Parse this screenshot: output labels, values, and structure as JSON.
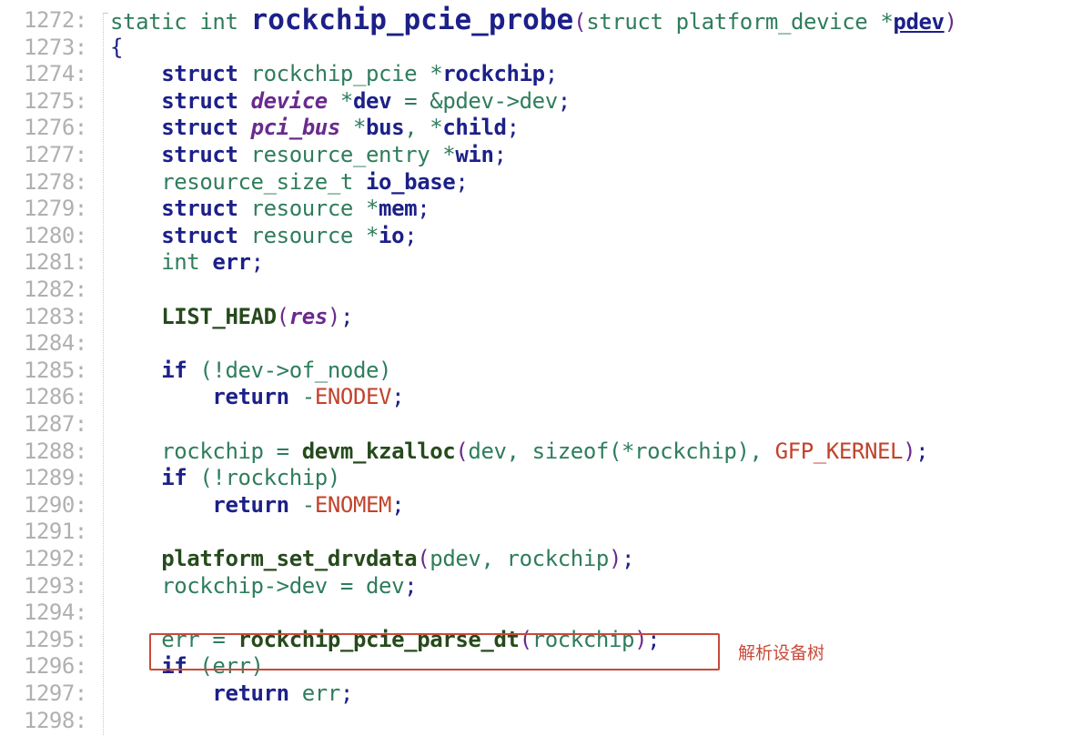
{
  "lines": [
    {
      "num": "1272:",
      "code": [
        [
          "kw-plain",
          "static int "
        ],
        [
          "fn",
          "rockchip_pcie_probe"
        ],
        [
          "paren",
          "("
        ],
        [
          "plain",
          "struct platform_device *"
        ],
        [
          "under",
          "pdev"
        ],
        [
          "paren",
          ")"
        ]
      ]
    },
    {
      "num": "1273:",
      "code": [
        [
          "punct",
          "{"
        ]
      ]
    },
    {
      "num": "1274:",
      "code": [
        [
          "pad",
          "    "
        ],
        [
          "kw",
          "struct"
        ],
        [
          "plain",
          " rockchip_pcie *"
        ],
        [
          "ident",
          "rockchip"
        ],
        [
          "punct",
          ";"
        ]
      ]
    },
    {
      "num": "1275:",
      "code": [
        [
          "pad",
          "    "
        ],
        [
          "kw",
          "struct"
        ],
        [
          "plain",
          " "
        ],
        [
          "typei",
          "device"
        ],
        [
          "plain",
          " *"
        ],
        [
          "ident",
          "dev"
        ],
        [
          "plain",
          " = &pdev->dev"
        ],
        [
          "punct",
          ";"
        ]
      ]
    },
    {
      "num": "1276:",
      "code": [
        [
          "pad",
          "    "
        ],
        [
          "kw",
          "struct"
        ],
        [
          "plain",
          " "
        ],
        [
          "typei",
          "pci_bus"
        ],
        [
          "plain",
          " *"
        ],
        [
          "ident",
          "bus"
        ],
        [
          "plain",
          ", *"
        ],
        [
          "ident",
          "child"
        ],
        [
          "punct",
          ";"
        ]
      ]
    },
    {
      "num": "1277:",
      "code": [
        [
          "pad",
          "    "
        ],
        [
          "kw",
          "struct"
        ],
        [
          "plain",
          " resource_entry *"
        ],
        [
          "ident",
          "win"
        ],
        [
          "punct",
          ";"
        ]
      ]
    },
    {
      "num": "1278:",
      "code": [
        [
          "pad",
          "    "
        ],
        [
          "plain",
          "resource_size_t "
        ],
        [
          "ident",
          "io_base"
        ],
        [
          "punct",
          ";"
        ]
      ]
    },
    {
      "num": "1279:",
      "code": [
        [
          "pad",
          "    "
        ],
        [
          "kw",
          "struct"
        ],
        [
          "plain",
          " resource *"
        ],
        [
          "ident",
          "mem"
        ],
        [
          "punct",
          ";"
        ]
      ]
    },
    {
      "num": "1280:",
      "code": [
        [
          "pad",
          "    "
        ],
        [
          "kw",
          "struct"
        ],
        [
          "plain",
          " resource *"
        ],
        [
          "ident",
          "io"
        ],
        [
          "punct",
          ";"
        ]
      ]
    },
    {
      "num": "1281:",
      "code": [
        [
          "pad",
          "    "
        ],
        [
          "plain",
          "int "
        ],
        [
          "ident",
          "err"
        ],
        [
          "punct",
          ";"
        ]
      ]
    },
    {
      "num": "1282:",
      "code": []
    },
    {
      "num": "1283:",
      "code": [
        [
          "pad",
          "    "
        ],
        [
          "call",
          "LIST_HEAD"
        ],
        [
          "paren",
          "("
        ],
        [
          "typei",
          "res"
        ],
        [
          "paren",
          ")"
        ],
        [
          "punct",
          ";"
        ]
      ]
    },
    {
      "num": "1284:",
      "code": []
    },
    {
      "num": "1285:",
      "code": [
        [
          "pad",
          "    "
        ],
        [
          "kw",
          "if"
        ],
        [
          "plain",
          " (!dev->of_node)"
        ]
      ]
    },
    {
      "num": "1286:",
      "code": [
        [
          "pad",
          "        "
        ],
        [
          "kw",
          "return"
        ],
        [
          "plain",
          " -"
        ],
        [
          "macro",
          "ENODEV"
        ],
        [
          "punct",
          ";"
        ]
      ]
    },
    {
      "num": "1287:",
      "code": []
    },
    {
      "num": "1288:",
      "code": [
        [
          "pad",
          "    "
        ],
        [
          "plain",
          "rockchip = "
        ],
        [
          "call",
          "devm_kzalloc"
        ],
        [
          "paren",
          "("
        ],
        [
          "plain",
          "dev, sizeof(*rockchip), "
        ],
        [
          "macro",
          "GFP_KERNEL"
        ],
        [
          "paren",
          ")"
        ],
        [
          "punct",
          ";"
        ]
      ]
    },
    {
      "num": "1289:",
      "code": [
        [
          "pad",
          "    "
        ],
        [
          "kw",
          "if"
        ],
        [
          "plain",
          " (!rockchip)"
        ]
      ]
    },
    {
      "num": "1290:",
      "code": [
        [
          "pad",
          "        "
        ],
        [
          "kw",
          "return"
        ],
        [
          "plain",
          " -"
        ],
        [
          "macro",
          "ENOMEM"
        ],
        [
          "punct",
          ";"
        ]
      ]
    },
    {
      "num": "1291:",
      "code": []
    },
    {
      "num": "1292:",
      "code": [
        [
          "pad",
          "    "
        ],
        [
          "call",
          "platform_set_drvdata"
        ],
        [
          "paren",
          "("
        ],
        [
          "plain",
          "pdev, rockchip"
        ],
        [
          "paren",
          ")"
        ],
        [
          "punct",
          ";"
        ]
      ]
    },
    {
      "num": "1293:",
      "code": [
        [
          "pad",
          "    "
        ],
        [
          "plain",
          "rockchip->dev = dev"
        ],
        [
          "punct",
          ";"
        ]
      ]
    },
    {
      "num": "1294:",
      "code": []
    },
    {
      "num": "1295:",
      "code": [
        [
          "pad",
          "    "
        ],
        [
          "plain",
          "err = "
        ],
        [
          "call",
          "rockchip_pcie_parse_dt"
        ],
        [
          "paren",
          "("
        ],
        [
          "plain",
          "rockchip"
        ],
        [
          "paren",
          ")"
        ],
        [
          "punct",
          ";"
        ]
      ]
    },
    {
      "num": "1296:",
      "code": [
        [
          "pad",
          "    "
        ],
        [
          "kw",
          "if"
        ],
        [
          "plain",
          " (err)"
        ]
      ]
    },
    {
      "num": "1297:",
      "code": [
        [
          "pad",
          "        "
        ],
        [
          "kw",
          "return"
        ],
        [
          "plain",
          " err"
        ],
        [
          "punct",
          ";"
        ]
      ]
    },
    {
      "num": "1298:",
      "code": []
    }
  ],
  "annotation": {
    "highlight_line": "1295:",
    "note": "解析设备树",
    "color": "#c94a3a"
  }
}
